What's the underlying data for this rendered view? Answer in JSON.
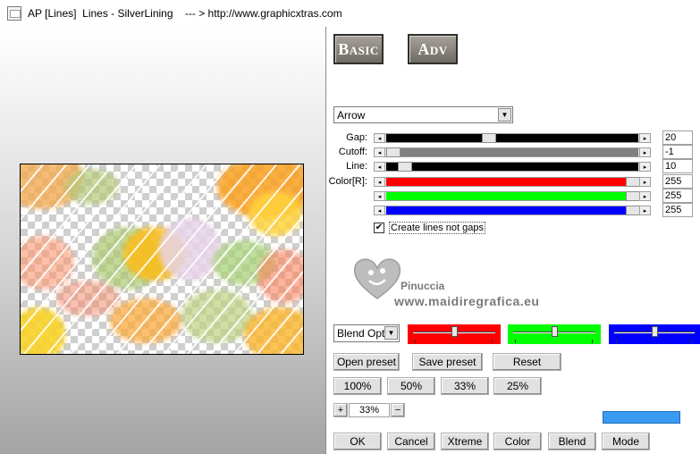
{
  "window": {
    "title": "AP [Lines]  Lines - SilverLining    --- > http://www.graphicxtras.com"
  },
  "modes": {
    "basic": "Basic",
    "adv": "Adv"
  },
  "style_select": {
    "value": "Arrow"
  },
  "sliders": [
    {
      "label": "Gap:",
      "value": "20",
      "position": 0.4,
      "color": "#000000"
    },
    {
      "label": "Cutoff:",
      "value": "-1",
      "position": 0.0,
      "color": "#808080"
    },
    {
      "label": "Line:",
      "value": "10",
      "position": 0.05,
      "color": "#000000"
    },
    {
      "label": "Color[R]:",
      "value": "255",
      "position": 1.0,
      "color": "#ff0000"
    },
    {
      "label": "",
      "value": "255",
      "position": 1.0,
      "color": "#00ff00"
    },
    {
      "label": "",
      "value": "255",
      "position": 1.0,
      "color": "#0000ff"
    }
  ],
  "checkbox": {
    "label": "Create lines not gaps",
    "checked": "✔"
  },
  "watermark": {
    "name": "Pinuccia",
    "url": "www.maidiregrafica.eu"
  },
  "blend_select": {
    "value": "Blend Opti"
  },
  "color_sliders": [
    {
      "color": "#ff0000",
      "position": 0.5
    },
    {
      "color": "#00ff00",
      "position": 0.5
    },
    {
      "color": "#0000ff",
      "position": 0.5
    }
  ],
  "presets": {
    "open": "Open preset",
    "save": "Save preset",
    "reset": "Reset"
  },
  "zoom_buttons": [
    "100%",
    "50%",
    "33%",
    "25%"
  ],
  "zoom": {
    "plus": "+",
    "value": "33%",
    "minus": "−"
  },
  "swatch_color": "#3a9bf0",
  "bottom_buttons": [
    "OK",
    "Cancel",
    "Xtreme",
    "Color",
    "Blend",
    "Mode"
  ]
}
